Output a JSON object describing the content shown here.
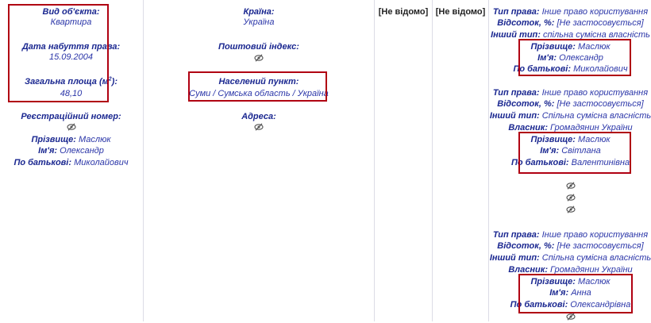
{
  "col1": {
    "object_type_label": "Вид об'єкта:",
    "object_type_value": "Квартира",
    "acq_date_label": "Дата набуття права:",
    "acq_date_value": "15.09.2004",
    "area_label_prefix": "Загальна площа (м",
    "area_label_sup": "2",
    "area_label_suffix": "):",
    "area_value": "48,10",
    "reg_number_label": "Реєстраційний номер:",
    "surname_label": "Прізвище:",
    "surname_value": "Маслюк",
    "name_label": "Ім'я:",
    "name_value": "Олександр",
    "patronymic_label": "По батькові:",
    "patronymic_value": "Миколайович"
  },
  "col2": {
    "country_label": "Країна:",
    "country_value": "Україна",
    "postal_label": "Поштовий індекс:",
    "settlement_label": "Населений пункт:",
    "settlement_value": "Суми / Сумська область / Україна",
    "address_label": "Адреса:"
  },
  "col3": {
    "value": "[Не відомо]"
  },
  "col4": {
    "value": "[Не відомо]"
  },
  "col5": {
    "owners": [
      {
        "right_type_label": "Тип права:",
        "right_type_value": "Інше право користування",
        "percent_label": "Відсоток, %:",
        "percent_value": "[Не застосовується]",
        "other_type_label": "Інший тип:",
        "other_type_value": "спільна сумісна власність",
        "surname_label": "Прізвище:",
        "surname_value": "Маслюк",
        "name_label": "Ім'я:",
        "name_value": "Олександр",
        "patronymic_label": "По батькові:",
        "patronymic_value": "Миколайович"
      },
      {
        "right_type_label": "Тип права:",
        "right_type_value": "Інше право користування",
        "percent_label": "Відсоток, %:",
        "percent_value": "[Не застосовується]",
        "other_type_label": "Інший тип:",
        "other_type_value": "Спільна сумісна власність",
        "owner_label": "Власник:",
        "owner_value": "Громадянин України",
        "surname_label": "Прізвище:",
        "surname_value": "Маслюк",
        "name_label": "Ім'я:",
        "name_value": "Світлана",
        "patronymic_label": "По батькові:",
        "patronymic_value": "Валентинівна"
      },
      {
        "right_type_label": "Тип права:",
        "right_type_value": "Інше право користування",
        "percent_label": "Відсоток, %:",
        "percent_value": "[Не застосовується]",
        "other_type_label": "Інший тип:",
        "other_type_value": "Спільна сумісна власність",
        "owner_label": "Власник:",
        "owner_value": "Громадянин України",
        "surname_label": "Прізвище:",
        "surname_value": "Маслюк",
        "name_label": "Ім'я:",
        "name_value": "Анна",
        "patronymic_label": "По батькові:",
        "patronymic_value": "Олександрівна"
      }
    ]
  },
  "icons": {
    "hidden": "eye-slash-icon"
  },
  "colors": {
    "text": "#2a35a8",
    "highlight_box": "#b00012"
  }
}
